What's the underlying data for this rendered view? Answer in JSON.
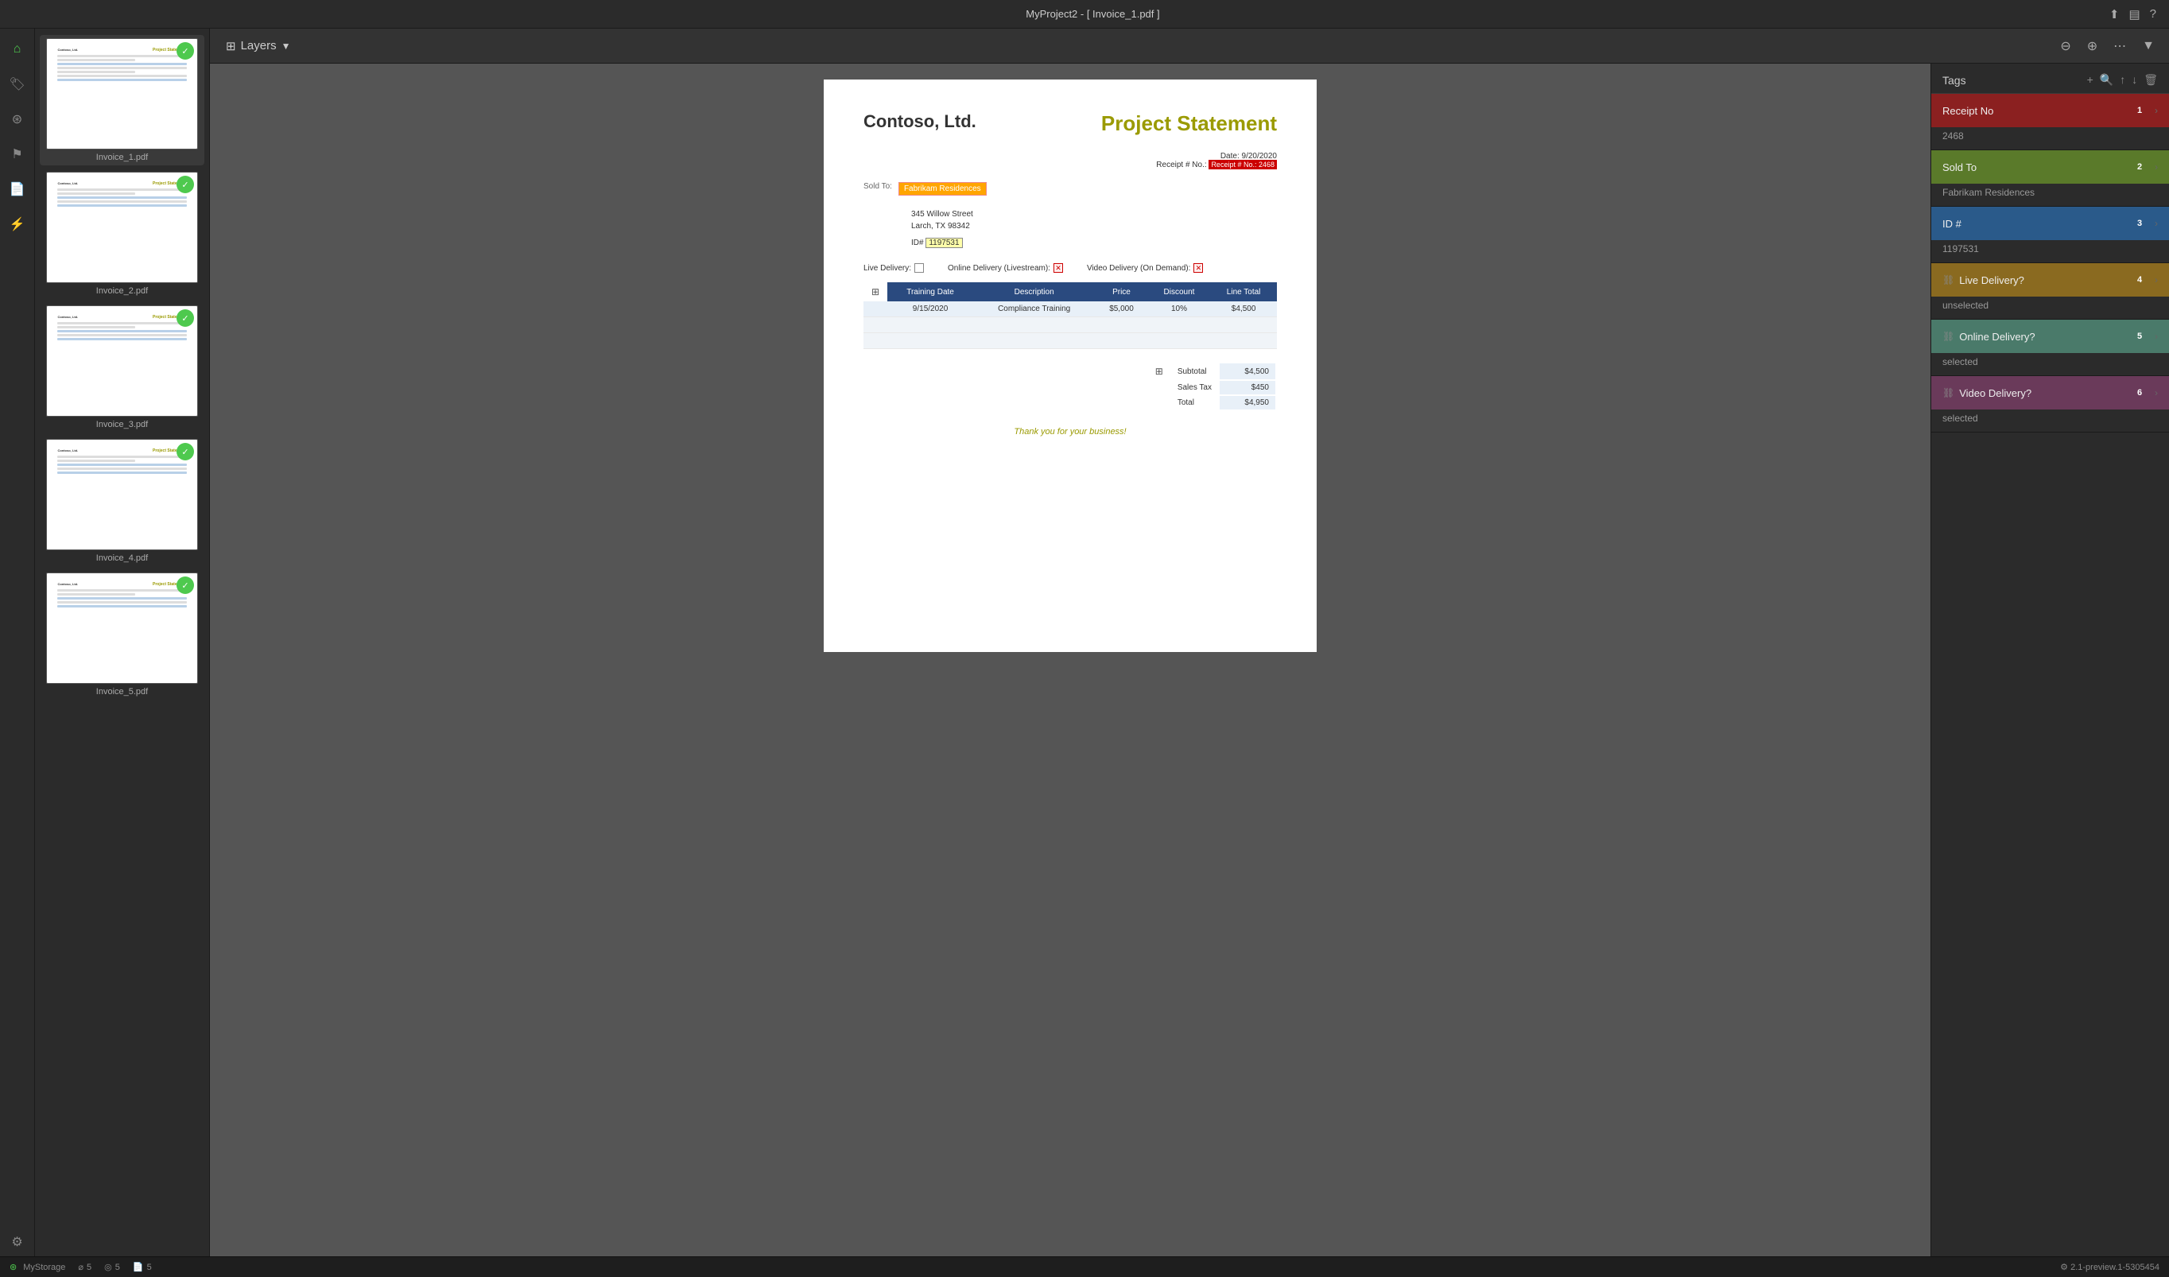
{
  "titleBar": {
    "title": "MyProject2 - [ Invoice_1.pdf ]",
    "actions": [
      "share",
      "layout",
      "help"
    ]
  },
  "toolbar": {
    "layersLabel": "Layers",
    "zoomOut": "−",
    "zoomIn": "+",
    "more": "⋯"
  },
  "filePanel": {
    "files": [
      {
        "name": "Invoice_1.pdf",
        "active": true
      },
      {
        "name": "Invoice_2.pdf",
        "active": false
      },
      {
        "name": "Invoice_3.pdf",
        "active": false
      },
      {
        "name": "Invoice_4.pdf",
        "active": false
      },
      {
        "name": "Invoice_5.pdf",
        "active": false
      }
    ]
  },
  "invoice": {
    "companyName": "Contoso, Ltd.",
    "title": "Project Statement",
    "date": "Date: 9/20/2020",
    "receiptNo": "Receipt # No.: 2468",
    "soldToLabel": "Sold To:",
    "soldToValue": "Fabrikam Residences",
    "address1": "345 Willow Street",
    "address2": "Larch, TX 98342",
    "idLabel": "ID#",
    "idValue": "1197531",
    "deliveries": [
      {
        "label": "Live Delivery:",
        "checked": false
      },
      {
        "label": "Online Delivery (Livestream):",
        "checked": true
      },
      {
        "label": "Video Delivery (On Demand):",
        "checked": true
      }
    ],
    "tableHeaders": [
      "Training Date",
      "Description",
      "Price",
      "Discount",
      "Line Total"
    ],
    "tableRows": [
      {
        "date": "9/15/2020",
        "description": "Compliance Training",
        "price": "$5,000",
        "discount": "10%",
        "total": "$4,500"
      },
      {
        "date": "",
        "description": "",
        "price": "",
        "discount": "",
        "total": ""
      },
      {
        "date": "",
        "description": "",
        "price": "",
        "discount": "",
        "total": ""
      }
    ],
    "subtotalLabel": "Subtotal",
    "subtotalValue": "$4,500",
    "taxLabel": "Sales Tax",
    "taxValue": "$450",
    "totalLabel": "Total",
    "totalValue": "$4,950",
    "thankYou": "Thank you for your business!"
  },
  "tags": {
    "title": "Tags",
    "items": [
      {
        "id": 1,
        "label": "Receipt No",
        "num": "1",
        "value": "2468",
        "hasIcon": false
      },
      {
        "id": 2,
        "label": "Sold To",
        "num": "2",
        "value": "Fabrikam Residences",
        "hasIcon": false
      },
      {
        "id": 3,
        "label": "ID #",
        "num": "3",
        "value": "1197531",
        "hasIcon": false
      },
      {
        "id": 4,
        "label": "Live Delivery?",
        "num": "4",
        "value": "unselected",
        "hasIcon": true
      },
      {
        "id": 5,
        "label": "Online Delivery?",
        "num": "5",
        "value": "selected",
        "hasIcon": true
      },
      {
        "id": 6,
        "label": "Video Delivery?",
        "num": "6",
        "value": "selected",
        "hasIcon": true
      }
    ]
  },
  "statusBar": {
    "storage": "MyStorage",
    "count1": "5",
    "count2": "5",
    "count3": "5",
    "version": "2.1-preview.1-5305454"
  }
}
